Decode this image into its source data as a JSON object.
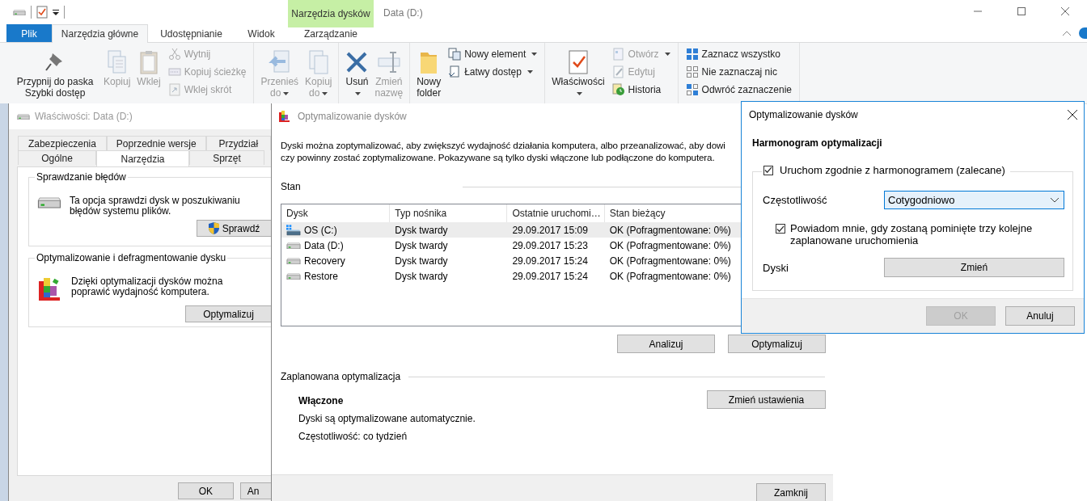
{
  "explorer": {
    "title": "Data (D:)",
    "context_group": "Narzędzia dysków",
    "tabs": [
      {
        "label": "Plik",
        "kind": "file",
        "selected": false
      },
      {
        "label": "Narzędzia główne",
        "kind": "normal",
        "selected": true
      },
      {
        "label": "Udostępnianie",
        "kind": "normal",
        "selected": false
      },
      {
        "label": "Widok",
        "kind": "normal",
        "selected": false
      },
      {
        "label": "Zarządzanie",
        "kind": "context",
        "selected": false
      }
    ],
    "ribbon_groups": [
      {
        "columns": [
          [
            {
              "label": "Przypnij do paska Szybki dostęp",
              "kind": "large",
              "disabled": false,
              "menu": false
            }
          ],
          [
            {
              "label": "Kopiuj",
              "kind": "large",
              "disabled": true,
              "menu": false
            }
          ],
          [
            {
              "label": "Wklej",
              "kind": "large",
              "disabled": true,
              "menu": false
            }
          ],
          [
            {
              "label": "Wytnij",
              "kind": "small",
              "disabled": true,
              "menu": false
            },
            {
              "label": "Kopiuj ścieżkę",
              "kind": "small",
              "disabled": true,
              "menu": false
            },
            {
              "label": "Wklej skrót",
              "kind": "small",
              "disabled": true,
              "menu": false
            }
          ]
        ]
      },
      {
        "columns": [
          [
            {
              "label": "Przenieś do",
              "kind": "large",
              "disabled": true,
              "menu": true
            }
          ],
          [
            {
              "label": "Kopiuj do",
              "kind": "large",
              "disabled": true,
              "menu": true
            }
          ]
        ]
      },
      {
        "columns": [
          [
            {
              "label": "Usuń",
              "kind": "large",
              "disabled": false,
              "menu": true
            }
          ],
          [
            {
              "label": "Zmień nazwę",
              "kind": "large",
              "disabled": true,
              "menu": false
            }
          ]
        ]
      },
      {
        "columns": [
          [
            {
              "label": "Nowy folder",
              "kind": "large",
              "disabled": false,
              "menu": false
            }
          ],
          [
            {
              "label": "Nowy element",
              "kind": "small",
              "disabled": false,
              "menu": true
            },
            {
              "label": "Łatwy dostęp",
              "kind": "small",
              "disabled": false,
              "menu": true
            }
          ]
        ]
      },
      {
        "columns": [
          [
            {
              "label": "Właściwości",
              "kind": "large",
              "disabled": false,
              "menu": true
            }
          ],
          [
            {
              "label": "Otwórz",
              "kind": "small",
              "disabled": true,
              "menu": true
            },
            {
              "label": "Edytuj",
              "kind": "small",
              "disabled": true,
              "menu": false
            },
            {
              "label": "Historia",
              "kind": "small",
              "disabled": false,
              "menu": false
            }
          ]
        ]
      },
      {
        "columns": [
          [
            {
              "label": "Zaznacz wszystko",
              "kind": "small",
              "disabled": false,
              "menu": false
            },
            {
              "label": "Nie zaznaczaj nic",
              "kind": "small",
              "disabled": false,
              "menu": false
            },
            {
              "label": "Odwróć zaznaczenie",
              "kind": "small",
              "disabled": false,
              "menu": false
            }
          ]
        ]
      }
    ]
  },
  "properties": {
    "title": "Właściwości: Data (D:)",
    "tab_rows": [
      [
        {
          "label": "Zabezpieczenia",
          "selected": false
        },
        {
          "label": "Poprzednie wersje",
          "selected": false
        },
        {
          "label": "Przydział",
          "selected": false
        }
      ],
      [
        {
          "label": "Ogólne",
          "selected": false
        },
        {
          "label": "Narzędzia",
          "selected": true
        },
        {
          "label": "Sprzęt",
          "selected": false
        }
      ]
    ],
    "groups": [
      {
        "title": "Sprawdzanie błędów",
        "text": "Ta opcja sprawdzi dysk w poszukiwaniu błędów systemu plików.",
        "button": "Sprawdź"
      },
      {
        "title": "Optymalizowanie i defragmentowanie dysku",
        "text": "Dzięki optymalizacji dysków można poprawić wydajność komputera.",
        "button": "Optymalizuj"
      }
    ],
    "buttons": [
      "OK",
      "An"
    ]
  },
  "optimize": {
    "title": "Optymalizowanie dysków",
    "description_lines": [
      "Dyski można zoptymalizować, aby zwiększyć wydajność działania komputera, albo przeanalizować, aby dowi",
      "czy powinny zostać zoptymalizowane. Pokazywane są tylko dyski włączone lub podłączone do komputera."
    ],
    "status_label": "Stan",
    "table": {
      "columns": [
        "Dysk",
        "Typ nośnika",
        "Ostatnie uruchomi…",
        "Stan bieżący"
      ],
      "rows": [
        {
          "kind": "system",
          "selected": true,
          "cells": [
            "OS (C:)",
            "Dysk twardy",
            "29.09.2017 15:09",
            "OK (Pofragmentowane: 0%)"
          ]
        },
        {
          "kind": "drive",
          "selected": false,
          "cells": [
            "Data (D:)",
            "Dysk twardy",
            "29.09.2017 15:23",
            "OK (Pofragmentowane: 0%)"
          ]
        },
        {
          "kind": "drive",
          "selected": false,
          "cells": [
            "Recovery",
            "Dysk twardy",
            "29.09.2017 15:24",
            "OK (Pofragmentowane: 0%)"
          ]
        },
        {
          "kind": "drive",
          "selected": false,
          "cells": [
            "Restore",
            "Dysk twardy",
            "29.09.2017 15:24",
            "OK (Pofragmentowane: 0%)"
          ]
        }
      ]
    },
    "buttons": [
      "Analizuj",
      "Optymalizuj"
    ],
    "schedule": {
      "title": "Zaplanowana optymalizacja",
      "state": "Włączone",
      "lines": [
        "Dyski są optymalizowane automatycznie.",
        "Częstotliwość: co tydzień"
      ],
      "button": "Zmień ustawienia"
    },
    "footer_button": "Zamknij"
  },
  "schedule_dialog": {
    "title": "Optymalizowanie dysków",
    "heading": "Harmonogram optymalizacji",
    "run_on_schedule": {
      "label": "Uruchom zgodnie z harmonogramem (zalecane)",
      "checked": true
    },
    "frequency": {
      "label": "Częstotliwość",
      "value": "Cotygodniowo"
    },
    "notify": {
      "label": "Powiadom mnie, gdy zostaną pominięte trzy kolejne zaplanowane uruchomienia",
      "checked": true
    },
    "drives": {
      "label": "Dyski",
      "button": "Zmień"
    },
    "buttons": [
      {
        "label": "OK",
        "disabled": true
      },
      {
        "label": "Anuluj",
        "disabled": false
      }
    ]
  }
}
